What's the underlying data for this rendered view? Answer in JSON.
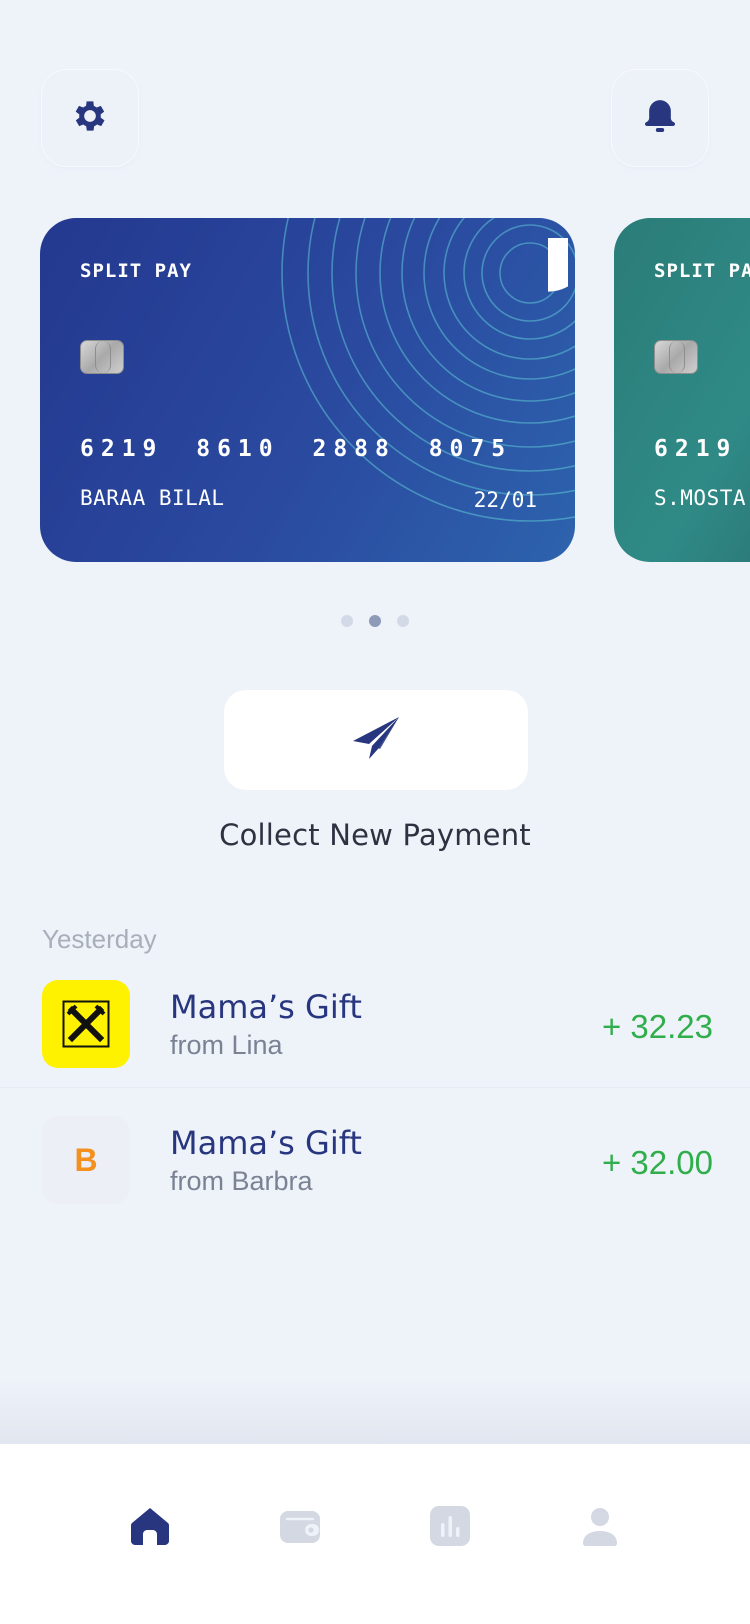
{
  "cards": [
    {
      "brand": "SPLIT PAY",
      "number": "6219 8610 2888 8075",
      "holder": "BARAA BILAL",
      "expiry": "22/01",
      "color": "#2a47a0"
    },
    {
      "brand": "SPLIT PAY",
      "number": "6219",
      "holder": "S.MOSTA",
      "color": "#2e8480"
    }
  ],
  "pagination": {
    "count": 3,
    "active": 1
  },
  "collect": {
    "label": "Collect New Payment"
  },
  "transactions": {
    "section_label": "Yesterday",
    "items": [
      {
        "title": "Mama’s Gift",
        "subtitle": "from Lina",
        "amount": "+ 32.23",
        "logo": "raiffeisen-logo"
      },
      {
        "title": "Mama’s Gift",
        "subtitle": "from Barbra",
        "amount": "+ 32.00",
        "logo_letter": "B"
      }
    ]
  },
  "icons": {
    "settings": "gear-icon",
    "notifications": "bell-icon",
    "send": "paper-plane-icon",
    "nav": [
      "home-icon",
      "wallet-icon",
      "chart-icon",
      "profile-icon"
    ]
  },
  "colors": {
    "primary": "#27367f",
    "positive": "#2fae4b",
    "background": "#eef2f9",
    "inactive": "#d3d8e3"
  }
}
